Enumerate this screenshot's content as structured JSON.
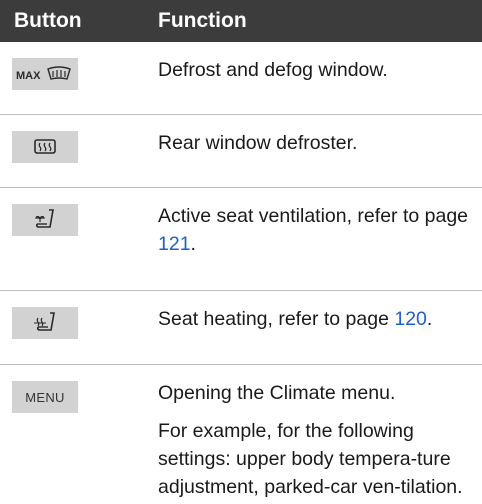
{
  "header": {
    "button": "Button",
    "function": "Function"
  },
  "rows": [
    {
      "icon": "max-defrost-icon",
      "icon_label": "MAX",
      "text": "Defrost and defog window."
    },
    {
      "icon": "rear-window-defrost-icon",
      "text": "Rear window defroster."
    },
    {
      "icon": "seat-ventilation-icon",
      "text_before": "Active seat ventilation, refer to page ",
      "link": "121",
      "text_after": "."
    },
    {
      "icon": "seat-heating-icon",
      "text_before": "Seat heating, refer to page ",
      "link": "120",
      "text_after": "."
    },
    {
      "icon": "menu-button-icon",
      "icon_label": "MENU",
      "text": "Opening the Climate menu.",
      "text2": "For example, for the following settings: upper body tempera-ture adjustment, parked-car ven-tilation."
    }
  ],
  "colors": {
    "header_bg": "#3c3c3c",
    "key_bg": "#d2d2d2",
    "link": "#1f5fc2",
    "divider": "#bdbdbd"
  }
}
